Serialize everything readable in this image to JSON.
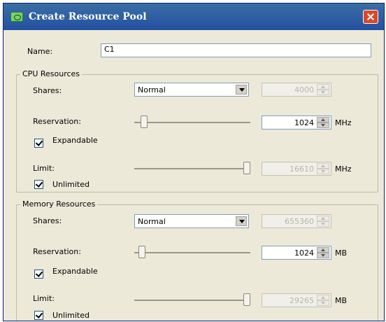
{
  "window": {
    "title": "Create Resource Pool"
  },
  "name_field": {
    "label": "Name:",
    "value": "C1"
  },
  "cpu": {
    "group_title": "CPU Resources",
    "shares_label": "Shares:",
    "shares_value": "Normal",
    "shares_number": "4000",
    "reservation_label": "Reservation:",
    "reservation_value": "1024",
    "reservation_unit": "MHz",
    "reservation_slider_fraction": 0.06,
    "expandable_label": "Expandable",
    "expandable_checked": true,
    "limit_label": "Limit:",
    "limit_value": "16610",
    "limit_unit": "MHz",
    "limit_slider_fraction": 1.0,
    "unlimited_label": "Unlimited",
    "unlimited_checked": true
  },
  "memory": {
    "group_title": "Memory Resources",
    "shares_label": "Shares:",
    "shares_value": "Normal",
    "shares_number": "655360",
    "reservation_label": "Reservation:",
    "reservation_value": "1024",
    "reservation_unit": "MB",
    "reservation_slider_fraction": 0.04,
    "expandable_label": "Expandable",
    "expandable_checked": true,
    "limit_label": "Limit:",
    "limit_value": "29265",
    "limit_unit": "MB",
    "limit_slider_fraction": 1.0,
    "unlimited_label": "Unlimited",
    "unlimited_checked": true
  }
}
